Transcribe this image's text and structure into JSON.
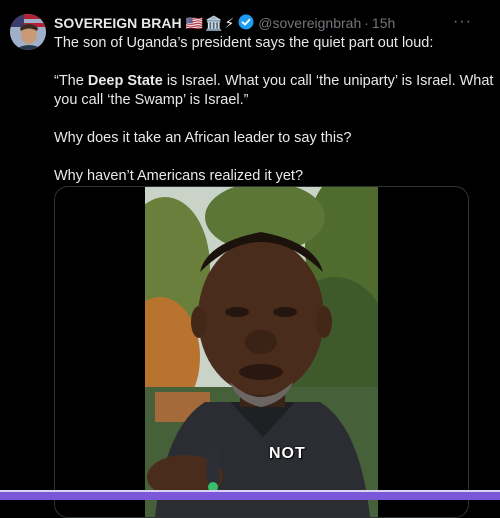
{
  "post": {
    "author_name": "SOVEREIGN BRAH",
    "author_emojis": [
      "🇺🇸",
      "🏛️",
      "⚡"
    ],
    "handle": "@sovereignbrah",
    "separator": "·",
    "time": "15h",
    "more_label": "···",
    "text": {
      "line1": "The son of Uganda’s president says the quiet part out loud:",
      "quote_open": "“The ",
      "quote_bold": "Deep State",
      "quote_rest": " is Israel. What you call ‘the uniparty’ is Israel. What you call ‘the Swamp’ is Israel.”",
      "para3": "Why does it take an African leader to say this?",
      "para4": "Why haven’t Americans realized it yet?"
    },
    "video": {
      "caption": "NOT"
    }
  },
  "colors": {
    "background": "#000000",
    "text": "#e7e9ea",
    "muted": "#71767b",
    "verified": "#1d9bf0",
    "card_border": "#2f3336"
  }
}
